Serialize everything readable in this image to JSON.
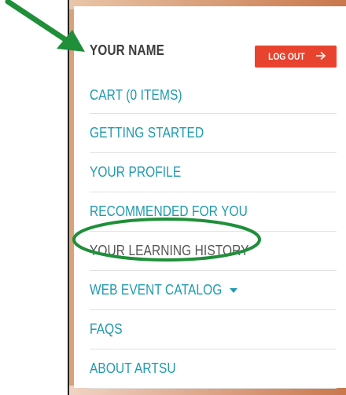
{
  "user": {
    "name": "YOUR NAME"
  },
  "logout": {
    "label": "LOG OUT",
    "icon": "arrow-right-icon"
  },
  "menu": {
    "items": [
      {
        "label": "CART (0 ITEMS)"
      },
      {
        "label": "GETTING STARTED"
      },
      {
        "label": "YOUR PROFILE"
      },
      {
        "label": "RECOMMENDED FOR YOU"
      },
      {
        "label": "YOUR LEARNING HISTORY"
      },
      {
        "label": "WEB EVENT CATALOG"
      },
      {
        "label": "FAQS"
      },
      {
        "label": "ABOUT ARTSU"
      }
    ]
  },
  "colors": {
    "accent": "#1e9aae",
    "logout_bg": "#e8432f",
    "annotation": "#1f8f3a"
  }
}
